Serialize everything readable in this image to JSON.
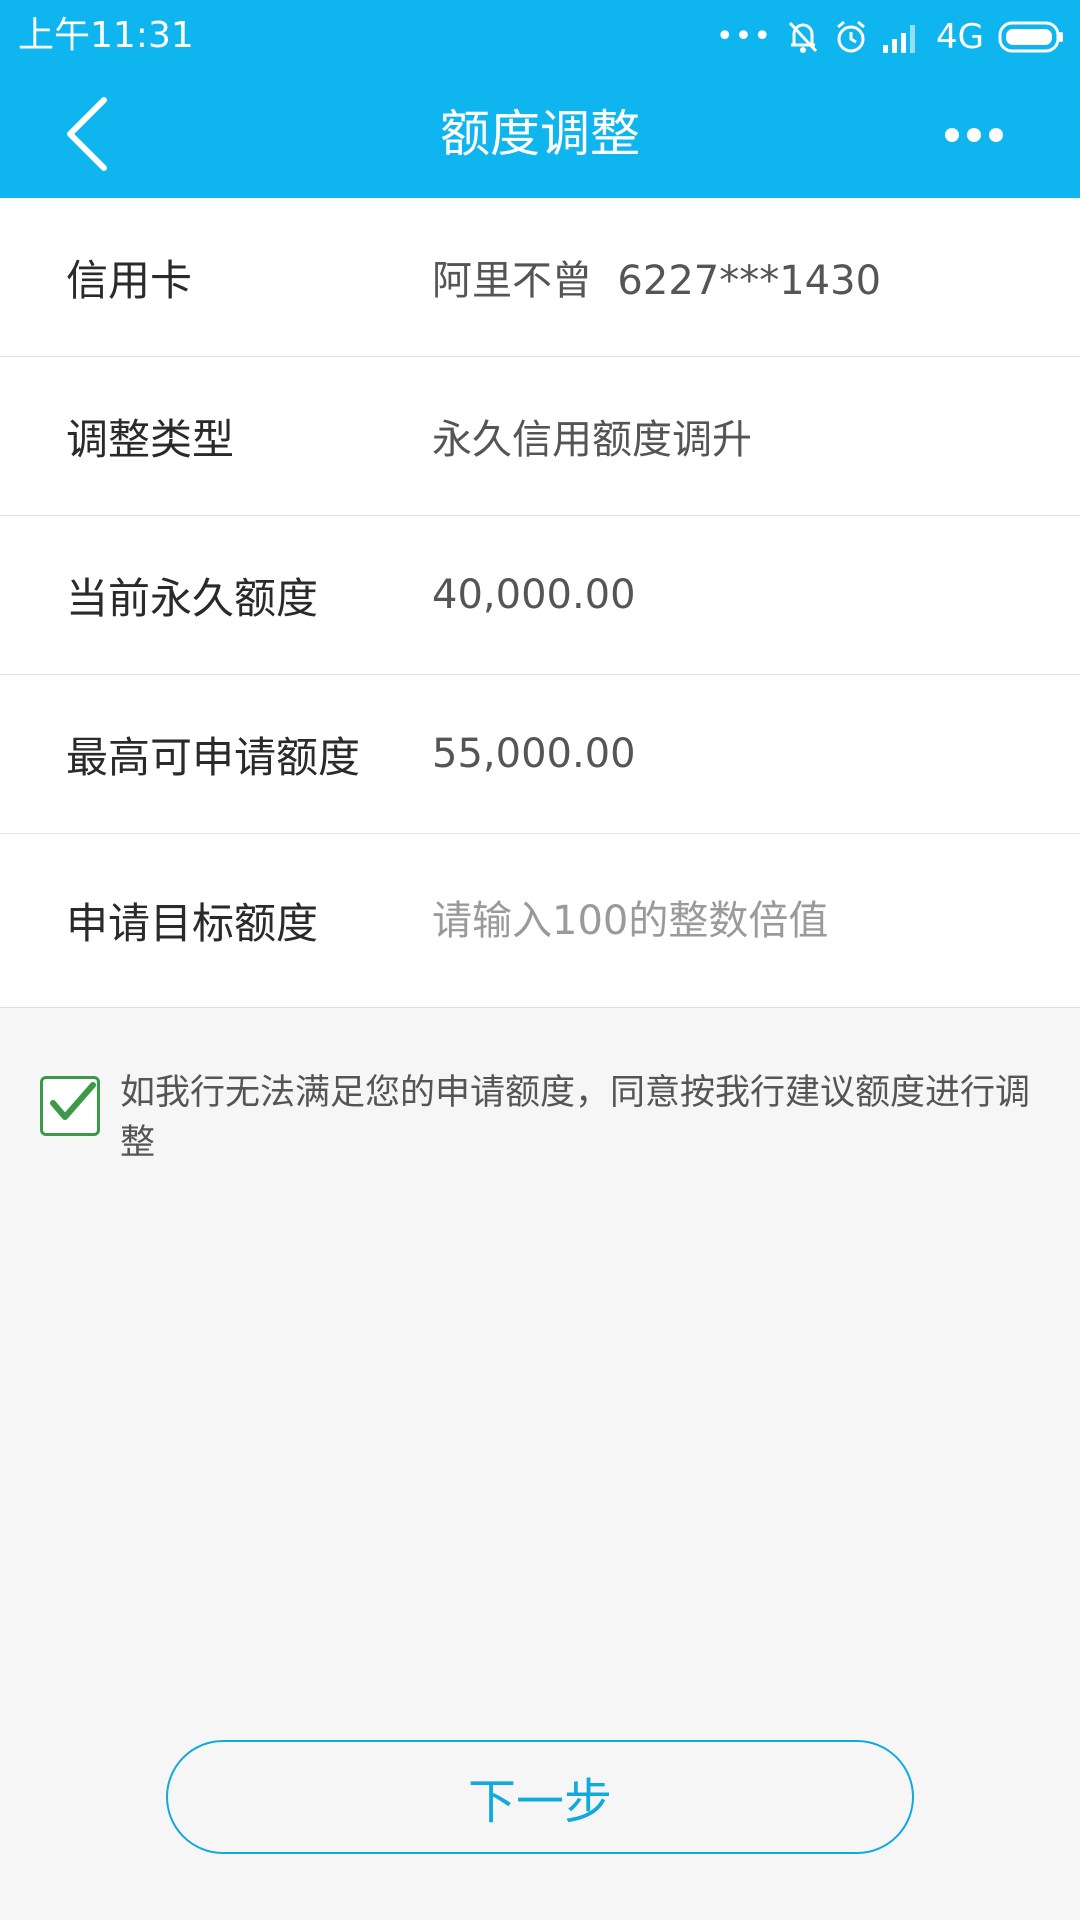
{
  "status_bar": {
    "time": "上午11:31",
    "network": "4G",
    "icons": [
      "more-dots-icon",
      "mute-bell-icon",
      "alarm-icon",
      "signal-icon",
      "battery-icon"
    ]
  },
  "nav": {
    "title": "额度调整",
    "back_icon": "chevron-left-icon",
    "more_icon": "more-dots-icon"
  },
  "form": {
    "rows": [
      {
        "label": "信用卡",
        "value": "阿里不曾  6227***1430"
      },
      {
        "label": "调整类型",
        "value": "永久信用额度调升"
      },
      {
        "label": "当前永久额度",
        "value": "40,000.00"
      },
      {
        "label": "最高可申请额度",
        "value": "55,000.00"
      }
    ],
    "target": {
      "label": "申请目标额度",
      "value": "",
      "placeholder": "请输入100的整数倍值"
    }
  },
  "agreement": {
    "checked": true,
    "text": "如我行无法满足您的申请额度，同意按我行建议额度进行调整"
  },
  "next_button": {
    "label": "下一步"
  },
  "colors": {
    "brand": "#0fb5ee",
    "button": "#12a9dd",
    "checkbox": "#3a9a48",
    "background": "#f6f6f7"
  }
}
